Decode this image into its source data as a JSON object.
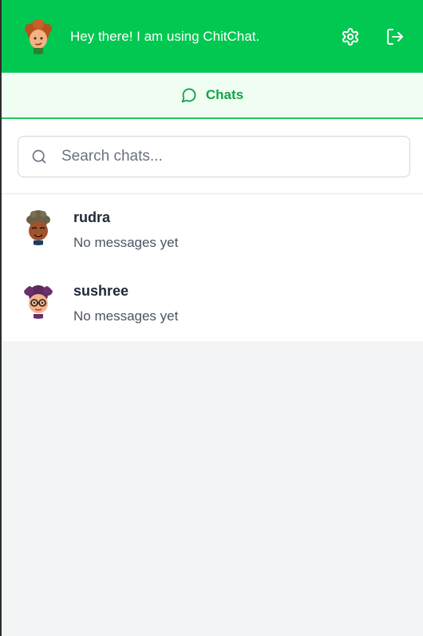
{
  "header": {
    "status_text": "Hey there! I am using ChitChat.",
    "avatar_icon": "user-avatar",
    "settings_icon": "gear-icon",
    "logout_icon": "logout-icon"
  },
  "tabs": [
    {
      "label": "Chats",
      "icon": "message-circle-icon",
      "active": true
    }
  ],
  "search": {
    "placeholder": "Search chats...",
    "value": ""
  },
  "chats": [
    {
      "name": "rudra",
      "preview": "No messages yet"
    },
    {
      "name": "sushree",
      "preview": "No messages yet"
    }
  ],
  "colors": {
    "brand_green": "#00c851",
    "tab_bg": "#effdf3",
    "tab_text": "#16a34a",
    "page_bg": "#f3f4f6"
  }
}
